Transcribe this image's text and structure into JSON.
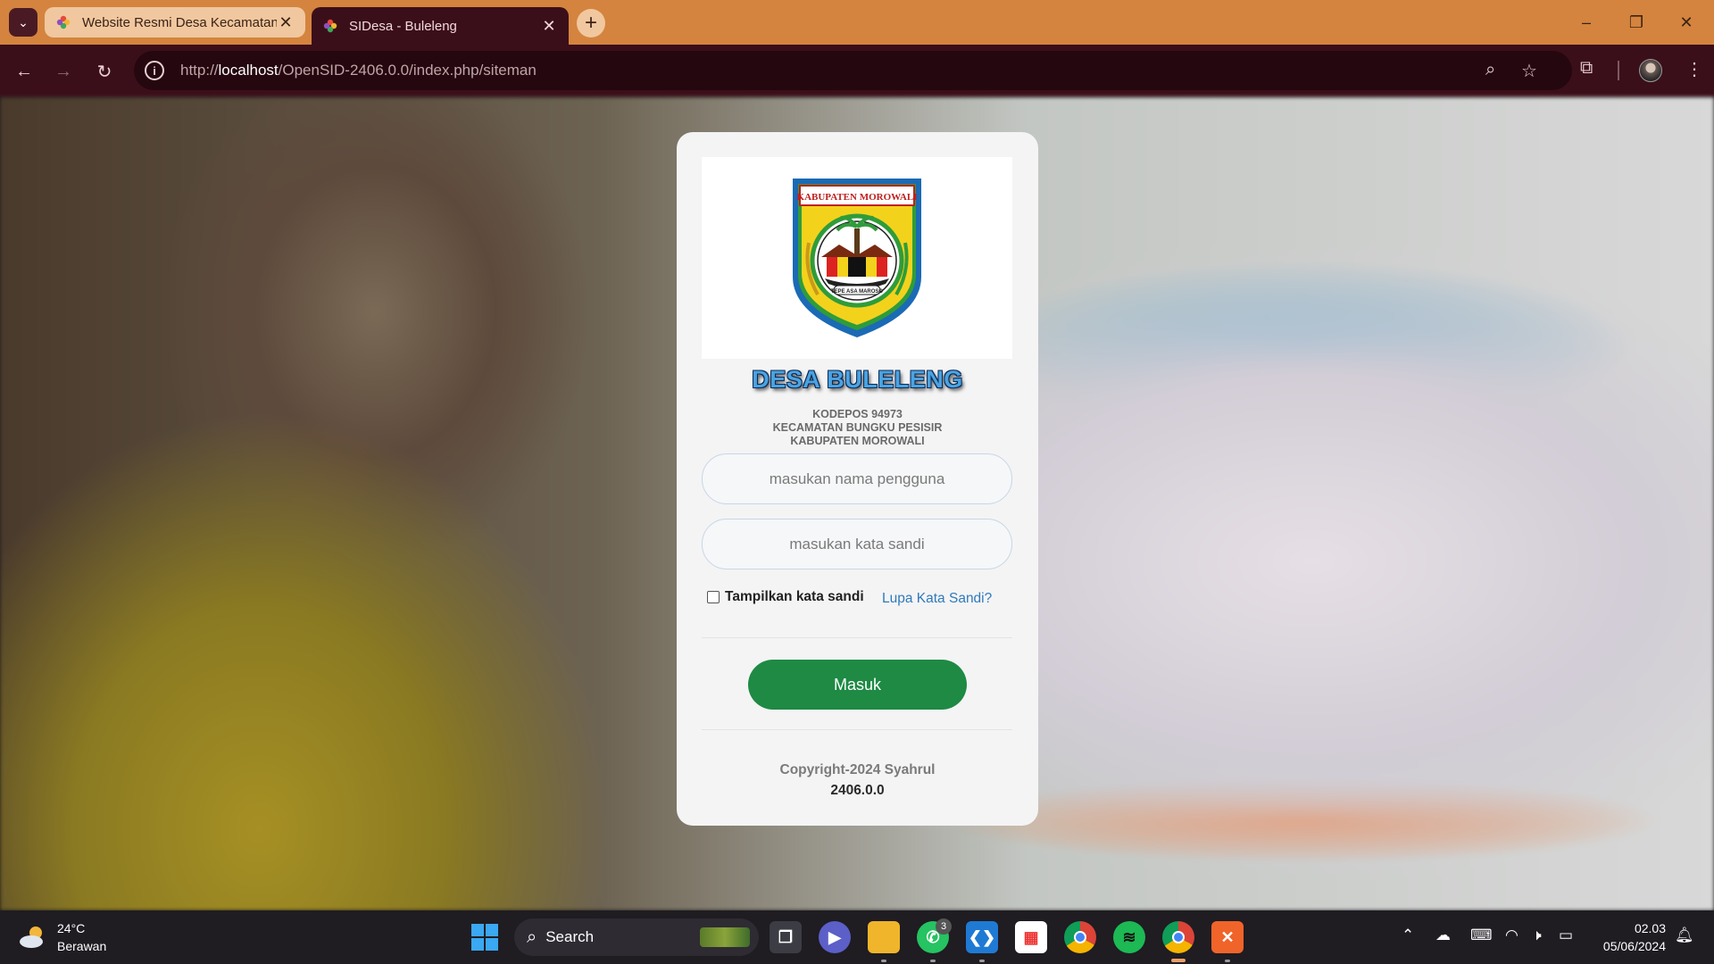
{
  "browser": {
    "tabs": [
      {
        "title": "Website Resmi Desa Kecamatan",
        "active": false
      },
      {
        "title": "SIDesa - Buleleng",
        "active": true
      }
    ],
    "new_tab": "+",
    "window_controls": {
      "minimize": "–",
      "restore": "❐",
      "close": "✕"
    },
    "url_host": "localhost",
    "url_prefix": "http://",
    "url_path": "/OpenSID-2406.0.0/index.php/siteman",
    "colors": {
      "frame": "#d4843e",
      "toolbar": "#3b0f1a"
    }
  },
  "login": {
    "logo": {
      "banner_text": "KABUPATEN MOROWALI",
      "motto": "TEPE ASA MAROSO"
    },
    "village_name": "DESA BULELENG",
    "postal": "KODEPOS 94973",
    "district": "KECAMATAN BUNGKU PESISIR",
    "regency": "KABUPATEN MOROWALI",
    "username_placeholder": "masukan nama pengguna",
    "password_placeholder": "masukan kata sandi",
    "show_password_label": "Tampilkan kata sandi",
    "show_password_checked": false,
    "forgot_password": "Lupa Kata Sandi?",
    "submit_label": "Masuk",
    "copyright": "Copyright-2024 Syahrul",
    "version": "2406.0.0",
    "colors": {
      "button": "#1e8a44",
      "title": "#4aa3e0",
      "link": "#2f7ab9"
    }
  },
  "taskbar": {
    "weather_temp": "24°C",
    "weather_desc": "Berawan",
    "search_label": "Search",
    "whatsapp_badge": "3",
    "clock_time": "02.03",
    "clock_date": "05/06/2024",
    "icons": [
      "windows-start-icon",
      "search-icon",
      "task-view-icon",
      "meet-icon",
      "file-explorer-icon",
      "whatsapp-icon",
      "vscode-icon",
      "microsoft-store-icon",
      "chrome-icon",
      "spotify-icon",
      "chrome-profile-icon",
      "xampp-icon"
    ]
  }
}
